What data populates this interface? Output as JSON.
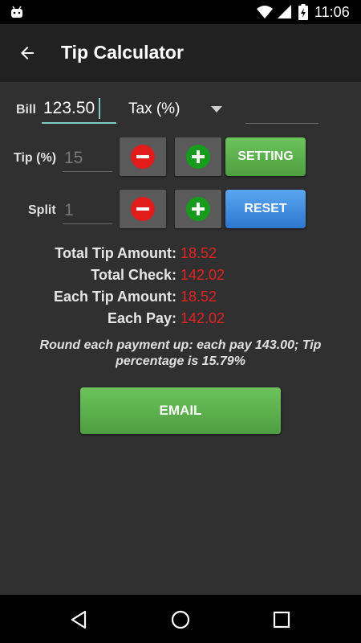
{
  "status_bar": {
    "time": "11:06"
  },
  "app_bar": {
    "title": "Tip Calculator"
  },
  "form": {
    "bill_label": "Bill",
    "bill_value": "123.50",
    "tax_spinner_value": "Tax (%)",
    "tax_value": "",
    "tip_label": "Tip (%)",
    "tip_placeholder": "15",
    "split_label": "Split",
    "split_placeholder": "1",
    "setting_label": "SETTING",
    "reset_label": "RESET"
  },
  "results": {
    "total_tip_label": "Total Tip Amount:",
    "total_tip_value": "18.52",
    "total_check_label": "Total Check:",
    "total_check_value": "142.02",
    "each_tip_label": "Each Tip Amount:",
    "each_tip_value": "18.52",
    "each_pay_label": "Each Pay:",
    "each_pay_value": "142.02"
  },
  "note": "Round each payment up: each pay 143.00; Tip percentage is 15.79%",
  "email_label": "EMAIL",
  "colors": {
    "background": "#303030",
    "app_bar": "#212121",
    "result_value": "#e42222",
    "green_button": "#5cb14c",
    "blue_button": "#3d8ae0",
    "minus": "#e21b1b",
    "plus": "#169b1d",
    "accent": "#80cbc4"
  }
}
